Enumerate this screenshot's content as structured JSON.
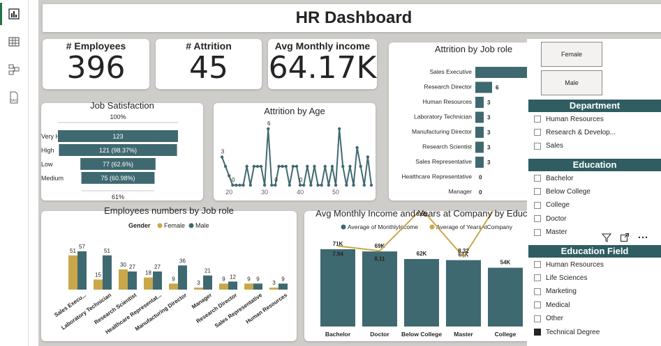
{
  "rail": {
    "items": [
      {
        "name": "report-view-icon"
      },
      {
        "name": "table-view-icon"
      },
      {
        "name": "model-view-icon"
      },
      {
        "name": "dax-query-view-icon",
        "label": "DAX"
      }
    ]
  },
  "title": "HR Dashboard",
  "kpis": {
    "employees": {
      "label": "# Employees",
      "value": "396"
    },
    "attrition": {
      "label": "# Attrition",
      "value": "45"
    },
    "income": {
      "label": "Avg Monthly income",
      "value": "64.17K"
    }
  },
  "colors": {
    "teal": "#3f6970",
    "gold": "#c9a74a",
    "header": "#2f5d62"
  },
  "charts": {
    "job_satisfaction": {
      "title": "Job Satisfaction",
      "top_label": "100%",
      "bottom_label": "61%",
      "categories": [
        "Very High",
        "High",
        "Low",
        "Medium"
      ],
      "values": [
        123,
        121,
        77,
        75
      ],
      "labels": [
        "123",
        "121 (98.37%)",
        "77 (62.6%)",
        "75 (60.98%)"
      ]
    },
    "attrition_by_age": {
      "title": "Attrition by Age",
      "x_ticks": [
        "20",
        "30",
        "40",
        "50"
      ],
      "xlim": [
        18,
        60
      ],
      "ylim": [
        0,
        6
      ],
      "x": [
        18,
        19,
        20,
        21,
        22,
        23,
        24,
        25,
        26,
        27,
        28,
        29,
        30,
        31,
        32,
        33,
        34,
        35,
        36,
        37,
        38,
        39,
        40,
        41,
        42,
        43,
        44,
        45,
        46,
        47,
        48,
        49,
        50,
        51,
        52,
        53,
        54,
        55,
        56,
        57,
        58,
        59,
        60
      ],
      "y": [
        3,
        2,
        1,
        0,
        0,
        0,
        0,
        2,
        0,
        2,
        2,
        2,
        0,
        6,
        0,
        0,
        2,
        2,
        2,
        0,
        2,
        2,
        0,
        0,
        2,
        0,
        2,
        0,
        0,
        2,
        0,
        2,
        0,
        6,
        2,
        0,
        2,
        0,
        4,
        2,
        0,
        3,
        0
      ],
      "point_labels": [
        {
          "index": 0,
          "text": "3"
        },
        {
          "index": 3,
          "text": "0"
        },
        {
          "index": 13,
          "text": "6"
        },
        {
          "index": 15,
          "text": "0"
        },
        {
          "index": 22,
          "text": "0"
        },
        {
          "index": 43,
          "text": "6"
        },
        {
          "index": 44,
          "text": "0"
        },
        {
          "index": 51,
          "text": "0"
        }
      ]
    },
    "attrition_by_role": {
      "title": "Attrition by Job role",
      "categories": [
        "Sales Executive",
        "Research Director",
        "Human Resources",
        "Laboratory Technician",
        "Manufacturing Director",
        "Research Scientist",
        "Sales Representative",
        "Healthcare Representative",
        "Manager"
      ],
      "values": [
        24,
        6,
        3,
        3,
        3,
        3,
        3,
        0,
        0
      ]
    },
    "employees_by_role": {
      "title": "Employees numbers by Job role",
      "legend_title": "Gender",
      "series_names": [
        "Female",
        "Male"
      ],
      "categories": [
        "Sales Execu...",
        "Laboratory Technician",
        "Research Scientist",
        "Healthcare Representat...",
        "Manufacturing Director",
        "Manager",
        "Research Director",
        "Sales Representative",
        "Human Resources"
      ],
      "female": [
        51,
        15,
        30,
        18,
        9,
        3,
        9,
        9,
        3
      ],
      "male": [
        57,
        51,
        27,
        27,
        36,
        21,
        12,
        9,
        9
      ]
    },
    "income_by_education": {
      "title": "Avg Monthly Income and Years at Company by Education",
      "series_names": [
        "Average of MonthlyIncome",
        "Average of YearsAtCompany"
      ],
      "categories": [
        "Bachelor",
        "Doctor",
        "Below College",
        "Master",
        "College"
      ],
      "income": [
        71,
        69,
        62,
        61,
        54
      ],
      "income_labels": [
        "71K",
        "69K",
        "62K",
        "61K",
        "54K"
      ],
      "years": [
        7.94,
        8.11,
        6.65,
        8.32,
        6.04
      ],
      "years_labels": [
        "7.94",
        "8.11",
        "6.65",
        "8.32",
        "6.04"
      ],
      "right_axis_ticks": [
        "8",
        "7",
        "6"
      ]
    }
  },
  "chart_data": [
    {
      "type": "bar",
      "title": "Attrition by Job role",
      "categories": [
        "Sales Executive",
        "Research Director",
        "Human Resources",
        "Laboratory Technician",
        "Manufacturing Director",
        "Research Scientist",
        "Sales Representative",
        "Healthcare Representative",
        "Manager"
      ],
      "values": [
        24,
        6,
        3,
        3,
        3,
        3,
        3,
        0,
        0
      ]
    },
    {
      "type": "bar",
      "title": "Job Satisfaction",
      "categories": [
        "Very High",
        "High",
        "Low",
        "Medium"
      ],
      "values": [
        123,
        121,
        77,
        75
      ]
    },
    {
      "type": "bar",
      "title": "Employees numbers by Job role",
      "categories": [
        "Sales Execu...",
        "Laboratory Technician",
        "Research Scientist",
        "Healthcare Representat...",
        "Manufacturing Director",
        "Manager",
        "Research Director",
        "Sales Representative",
        "Human Resources"
      ],
      "series": [
        {
          "name": "Female",
          "values": [
            51,
            15,
            30,
            18,
            9,
            3,
            9,
            9,
            3
          ]
        },
        {
          "name": "Male",
          "values": [
            57,
            51,
            27,
            27,
            36,
            21,
            12,
            9,
            9
          ]
        }
      ]
    },
    {
      "type": "bar",
      "title": "Avg Monthly Income and Years at Company by Education",
      "categories": [
        "Bachelor",
        "Doctor",
        "Below College",
        "Master",
        "College"
      ],
      "series": [
        {
          "name": "Average of MonthlyIncome",
          "values": [
            71000,
            69000,
            62000,
            61000,
            54000
          ]
        },
        {
          "name": "Average of YearsAtCompany",
          "values": [
            7.94,
            8.11,
            6.65,
            8.32,
            6.04
          ]
        }
      ]
    },
    {
      "type": "line",
      "title": "Attrition by Age",
      "xlim": [
        18,
        60
      ]
    }
  ],
  "slicers": {
    "gender": [
      "Female",
      "Male"
    ],
    "department": {
      "title": "Department",
      "items": [
        "Human Resources",
        "Research & Develop...",
        "Sales"
      ]
    },
    "education": {
      "title": "Education",
      "items": [
        "Bachelor",
        "Below College",
        "College",
        "Doctor",
        "Master"
      ]
    },
    "education_field": {
      "title": "Education Field",
      "items": [
        "Human Resources",
        "Life Sciences",
        "Marketing",
        "Medical",
        "Other",
        "Technical Degree"
      ],
      "checked": "Technical Degree"
    }
  }
}
